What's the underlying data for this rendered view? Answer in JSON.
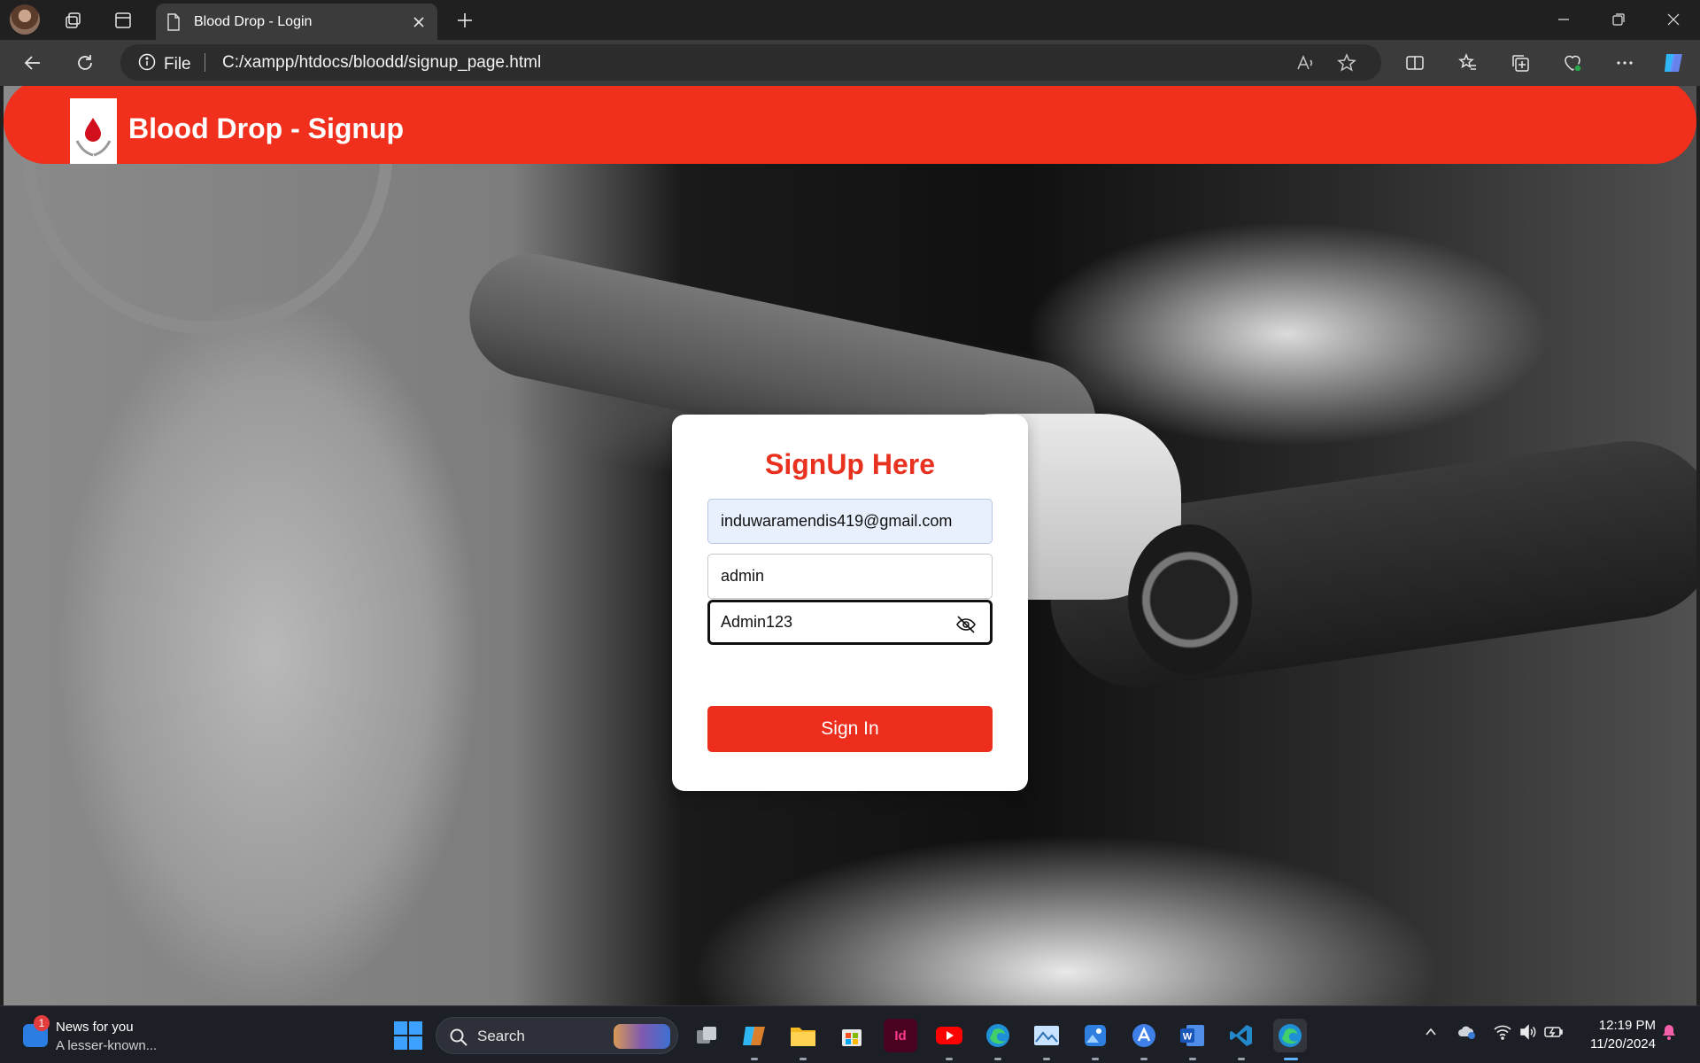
{
  "browser": {
    "tab_title": "Blood Drop - Login",
    "address_prefix": "File",
    "url": "C:/xampp/htdocs/bloodd/signup_page.html"
  },
  "page": {
    "app_title": "Blood Drop - Signup",
    "form": {
      "title": "SignUp Here",
      "email_value": "induwaramendis419@gmail.com",
      "username_value": "admin",
      "password_value": "Admin123",
      "submit_label": "Sign In"
    }
  },
  "taskbar": {
    "news_title": "News for you",
    "news_subtitle": "A lesser-known...",
    "news_badge": "1",
    "search_label": "Search",
    "apps": [
      "task-view",
      "copilot",
      "file-explorer",
      "microsoft-store",
      "indesign",
      "youtube",
      "edge",
      "photos-viewer",
      "photos",
      "app-store",
      "word",
      "vscode",
      "edge-dev"
    ],
    "time": "12:19 PM",
    "date": "11/20/2024"
  },
  "colors": {
    "brand_red": "#f0301d",
    "button_red": "#ee2e1c",
    "title_red": "#e8311f",
    "autofill_blue": "#e8f0fe"
  }
}
